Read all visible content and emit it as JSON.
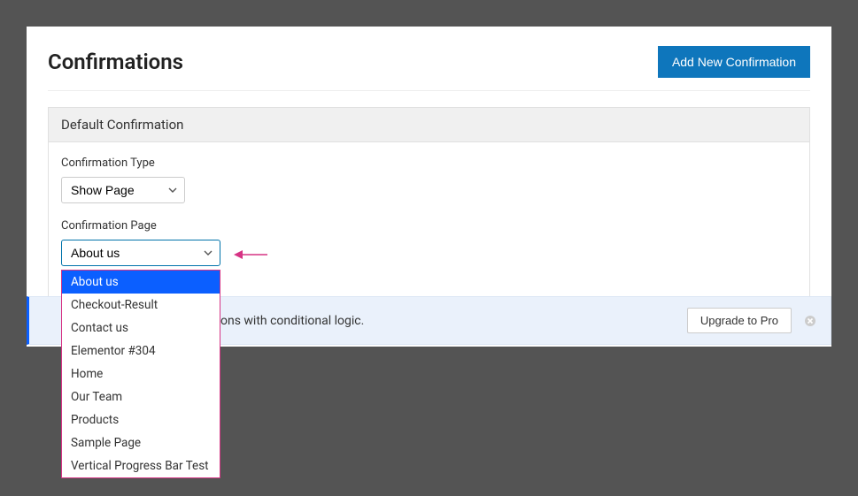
{
  "header": {
    "title": "Confirmations",
    "add_button": "Add New Confirmation"
  },
  "section": {
    "title": "Default Confirmation"
  },
  "confirmation_type": {
    "label": "Confirmation Type",
    "value": "Show Page"
  },
  "confirmation_page": {
    "label": "Confirmation Page",
    "value": "About us",
    "options": [
      "About us",
      "Checkout-Result",
      "Contact us",
      "Elementor #304",
      "Home",
      "Our Team",
      "Products",
      "Sample Page",
      "Vertical Progress Bar Test"
    ]
  },
  "notice": {
    "text_suffix": "tions with conditional logic.",
    "upgrade": "Upgrade to Pro"
  }
}
